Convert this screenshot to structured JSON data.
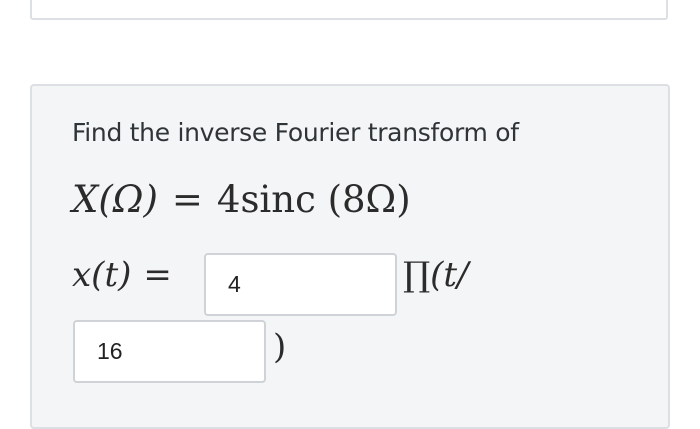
{
  "question": {
    "prompt": "Find the inverse Fourier transform of",
    "given_lhs": "X(Ω)",
    "equals": "=",
    "given_rhs": "4sinc (8Ω)",
    "answer_lhs": "x(t)",
    "answer_equals": "=",
    "rect_symbol": "∏",
    "rect_arg_start": "(t/",
    "closing_paren": ")"
  },
  "inputs": {
    "amplitude_value": "4",
    "width_value": "16"
  }
}
